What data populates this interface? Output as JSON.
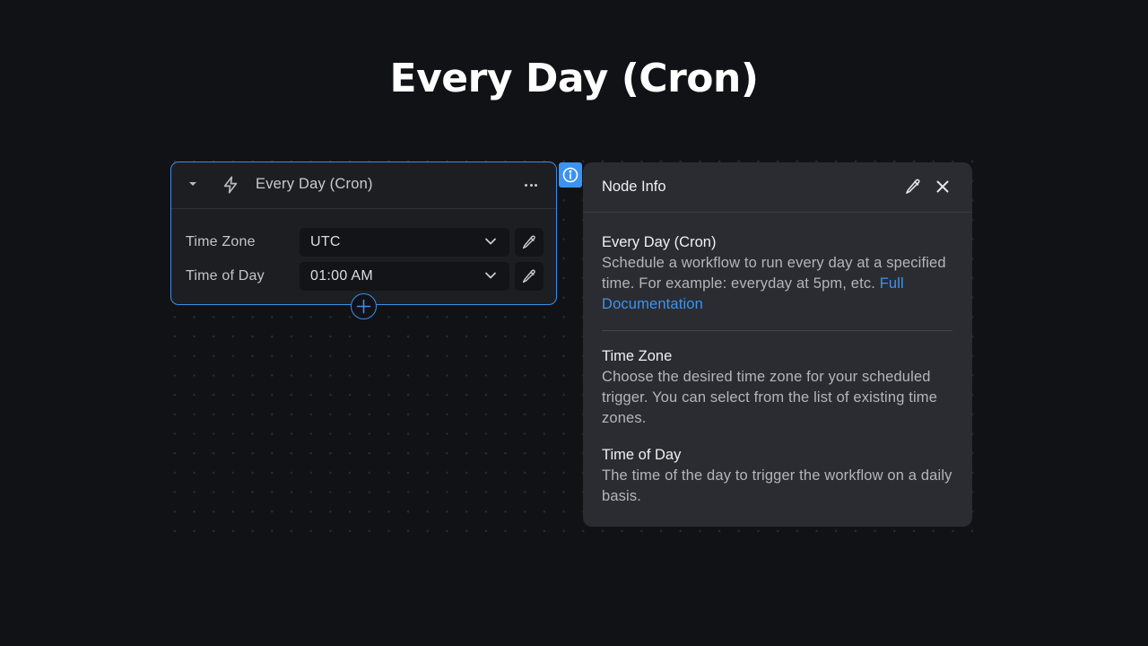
{
  "page": {
    "title": "Every Day (Cron)"
  },
  "node": {
    "title": "Every Day (Cron)",
    "icon": "bolt-icon",
    "fields": [
      {
        "label": "Time Zone",
        "value": "UTC"
      },
      {
        "label": "Time of Day",
        "value": "01:00 AM"
      }
    ]
  },
  "panel": {
    "title": "Node Info",
    "intro": {
      "title": "Every Day (Cron)",
      "text": "Schedule a workflow to run every day at a specified time. For example: everyday at 5pm, etc.",
      "link_label": "Full Documentation"
    },
    "sections": [
      {
        "title": "Time Zone",
        "text": "Choose the desired time zone for your scheduled trigger. You can select from the list of existing time zones."
      },
      {
        "title": "Time of Day",
        "text": "The time of the day to trigger the workflow on a daily basis."
      }
    ]
  },
  "colors": {
    "background": "#111216",
    "accent": "#3a8ee6",
    "node_bg": "#1d1e22",
    "panel_bg": "#2b2c31",
    "link": "#3b94f0"
  }
}
